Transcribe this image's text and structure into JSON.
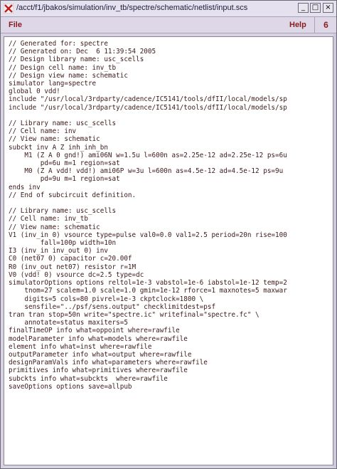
{
  "window": {
    "title": "/acct/f1/jbakos/simulation/inv_tb/spectre/schematic/netlist/input.scs",
    "controls": {
      "minimize": "_",
      "maximize": "□",
      "close": "×"
    }
  },
  "menubar": {
    "file": "File",
    "help": "Help",
    "number": "6"
  },
  "editor": {
    "lines": [
      "// Generated for: spectre",
      "// Generated on: Dec  6 11:39:54 2005",
      "// Design library name: usc_scells",
      "// Design cell name: inv_tb",
      "// Design view name: schematic",
      "simulator lang=spectre",
      "global 0 vdd!",
      "include \"/usr/local/3rdparty/cadence/IC5141/tools/dfII/local/models/sp",
      "include \"/usr/local/3rdparty/cadence/IC5141/tools/dfII/local/models/sp",
      "",
      "// Library name: usc_scells",
      "// Cell name: inv",
      "// View name: schematic",
      "subckt inv A Z inh_inh_bn",
      "    M1 (Z A 0 gnd!) ami06N w=1.5u l=600n as=2.25e-12 ad=2.25e-12 ps=6u",
      "        pd=6u m=1 region=sat",
      "    M0 (Z A vdd! vdd!) ami06P w=3u l=600n as=4.5e-12 ad=4.5e-12 ps=9u",
      "        pd=9u m=1 region=sat",
      "ends inv",
      "// End of subcircuit definition.",
      "",
      "// Library name: usc_scells",
      "// Cell name: inv_tb",
      "// View name: schematic",
      "V1 (inv_in 0) vsource type=pulse val0=0.0 val1=2.5 period=20n rise=100",
      "        fall=100p width=10n",
      "I3 (inv_in inv_out 0) inv",
      "C0 (net07 0) capacitor c=20.00f",
      "R0 (inv_out net07) resistor r=1M",
      "V0 (vdd! 0) vsource dc=2.5 type=dc",
      "simulatorOptions options reltol=1e-3 vabstol=1e-6 iabstol=1e-12 temp=2",
      "    tnom=27 scalem=1.0 scale=1.0 gmin=1e-12 rforce=1 maxnotes=5 maxwar",
      "    digits=5 cols=80 pivrel=1e-3 ckptclock=1800 \\",
      "    sensfile=\"../psf/sens.output\" checklimitdest=psf",
      "tran tran stop=50n write=\"spectre.ic\" writefinal=\"spectre.fc\" \\",
      "    annotate=status maxiters=5",
      "finalTimeOP info what=oppoint where=rawfile",
      "modelParameter info what=models where=rawfile",
      "element info what=inst where=rawfile",
      "outputParameter info what=output where=rawfile",
      "designParamVals info what=parameters where=rawfile",
      "primitives info what=primitives where=rawfile",
      "subckts info what=subckts  where=rawfile",
      "saveOptions options save=allpub"
    ]
  }
}
